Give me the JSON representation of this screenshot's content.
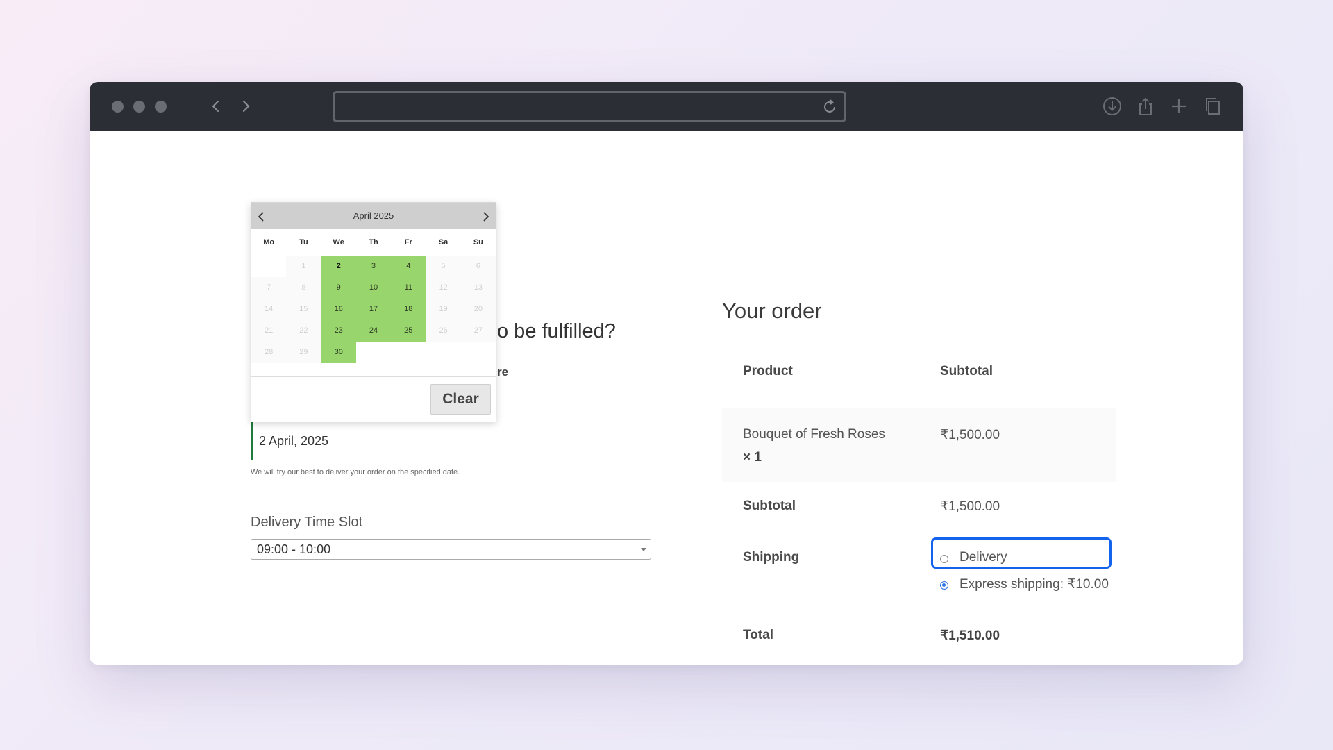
{
  "browser": {
    "icons": [
      "back-icon",
      "forward-icon",
      "reload-icon",
      "download-icon",
      "share-icon",
      "new-tab-icon",
      "tabs-icon"
    ]
  },
  "calendar": {
    "month_label": "April 2025",
    "weekdays": [
      "Mo",
      "Tu",
      "We",
      "Th",
      "Fr",
      "Sa",
      "Su"
    ],
    "days": [
      {
        "label": "",
        "state": "empty"
      },
      {
        "label": "1",
        "state": "disabled"
      },
      {
        "label": "2",
        "state": "selected"
      },
      {
        "label": "3",
        "state": "available"
      },
      {
        "label": "4",
        "state": "available"
      },
      {
        "label": "5",
        "state": "disabled"
      },
      {
        "label": "6",
        "state": "disabled"
      },
      {
        "label": "7",
        "state": "disabled"
      },
      {
        "label": "8",
        "state": "disabled"
      },
      {
        "label": "9",
        "state": "available"
      },
      {
        "label": "10",
        "state": "available"
      },
      {
        "label": "11",
        "state": "available"
      },
      {
        "label": "12",
        "state": "disabled"
      },
      {
        "label": "13",
        "state": "disabled"
      },
      {
        "label": "14",
        "state": "disabled"
      },
      {
        "label": "15",
        "state": "disabled"
      },
      {
        "label": "16",
        "state": "available"
      },
      {
        "label": "17",
        "state": "available"
      },
      {
        "label": "18",
        "state": "available"
      },
      {
        "label": "19",
        "state": "disabled"
      },
      {
        "label": "20",
        "state": "disabled"
      },
      {
        "label": "21",
        "state": "disabled"
      },
      {
        "label": "22",
        "state": "disabled"
      },
      {
        "label": "23",
        "state": "available"
      },
      {
        "label": "24",
        "state": "available"
      },
      {
        "label": "25",
        "state": "available"
      },
      {
        "label": "26",
        "state": "disabled"
      },
      {
        "label": "27",
        "state": "disabled"
      },
      {
        "label": "28",
        "state": "disabled"
      },
      {
        "label": "29",
        "state": "disabled"
      },
      {
        "label": "30",
        "state": "available"
      }
    ],
    "clear_label": "Clear",
    "available_color": "#98d56d"
  },
  "delivery": {
    "question_fragment": "o be fulfilled?",
    "sub_fragment": "re",
    "selected_date": "2 April, 2025",
    "note": "We will try our best to deliver your order on the specified date.",
    "time_slot_label": "Delivery Time Slot",
    "time_slot_value": "09:00 - 10:00"
  },
  "order": {
    "title": "Your order",
    "col_product": "Product",
    "col_subtotal": "Subtotal",
    "item_name": "Bouquet of Fresh Roses",
    "item_qty": "× 1",
    "item_price": "₹1,500.00",
    "subtotal_label": "Subtotal",
    "subtotal_value": "₹1,500.00",
    "shipping_label": "Shipping",
    "shipping_options": [
      "Delivery",
      "Express shipping: ₹10.00"
    ],
    "shipping_selected": "Express shipping: ₹10.00",
    "total_label": "Total",
    "total_value": "₹1,510.00",
    "highlight_color": "#1463ed"
  }
}
